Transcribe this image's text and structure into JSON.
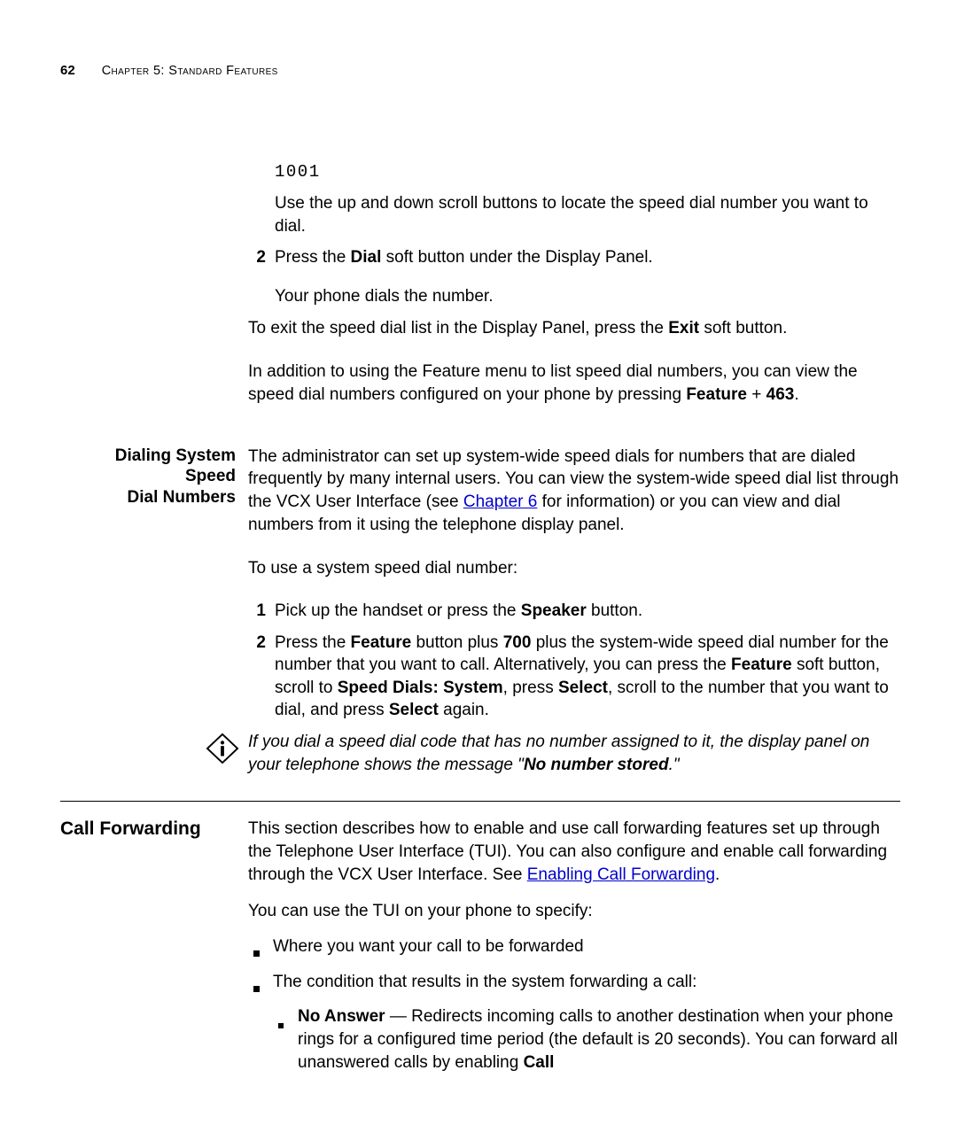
{
  "header": {
    "page_num": "62",
    "chapter": "Chapter 5: Standard Features"
  },
  "top_continued": {
    "code": "1001",
    "use_scroll": "Use the up and down scroll buttons to locate the speed dial number you want to dial.",
    "step2_num": "2",
    "step2_a": "Press the ",
    "step2_b_bold": "Dial",
    "step2_c": " soft button under the Display Panel.",
    "step2_sub": "Your phone dials the number.",
    "exit_a": "To exit the speed dial list in the Display Panel, press the ",
    "exit_b_bold": "Exit",
    "exit_c": " soft button.",
    "addition_a": "In addition to using the Feature menu to list speed dial numbers, you can view the speed dial numbers configured on your phone by pressing ",
    "addition_b_bold": "Feature",
    "addition_c": " + ",
    "addition_d_bold": "463",
    "addition_e": "."
  },
  "dialing": {
    "head1": "Dialing System Speed",
    "head2": "Dial Numbers",
    "p1_a": "The administrator can set up system-wide speed dials for numbers that are dialed frequently by many internal users. You can view the system-wide speed dial list through the VCX User Interface (see ",
    "p1_link": "Chapter 6",
    "p1_b": " for information) or you can view and dial numbers from it using the telephone display panel.",
    "p2": "To use a system speed dial number:",
    "s1_num": "1",
    "s1_a": "Pick up the handset or press the ",
    "s1_b_bold": "Speaker",
    "s1_c": " button.",
    "s2_num": "2",
    "s2_a": "Press the ",
    "s2_b_bold": "Feature",
    "s2_c": " button plus ",
    "s2_d_bold": "700",
    "s2_e": " plus the system-wide speed dial number for the number that you want to call. Alternatively, you can press the ",
    "s2_f_bold": "Feature",
    "s2_g": " soft button, scroll to ",
    "s2_h_bold": "Speed Dials: System",
    "s2_i": ", press ",
    "s2_j_bold": "Select",
    "s2_k": ", scroll to the number that you want to dial, and press ",
    "s2_l_bold": "Select",
    "s2_m": " again.",
    "note_a": "If you dial a speed dial code that has no number assigned to it, the display panel on your telephone shows the message \"",
    "note_b_bolditalic": "No number stored",
    "note_c": ".\""
  },
  "call_fwd": {
    "head": "Call Forwarding",
    "p1_a": "This section describes how to enable and use call forwarding features set up through the Telephone User Interface (TUI). You can also configure and enable call forwarding through the VCX User Interface. See ",
    "p1_link": "Enabling Call Forwarding",
    "p1_b": ".",
    "p2": "You can use the TUI on your phone to specify:",
    "b1": "Where you want your call to be forwarded",
    "b2": "The condition that results in the system forwarding a call:",
    "sb1_a_bold": "No Answer",
    "sb1_b": " — Redirects incoming calls to another destination when your phone rings for a configured time period (the default is 20 seconds). You can forward all unanswered calls by enabling ",
    "sb1_c_bold": "Call"
  }
}
